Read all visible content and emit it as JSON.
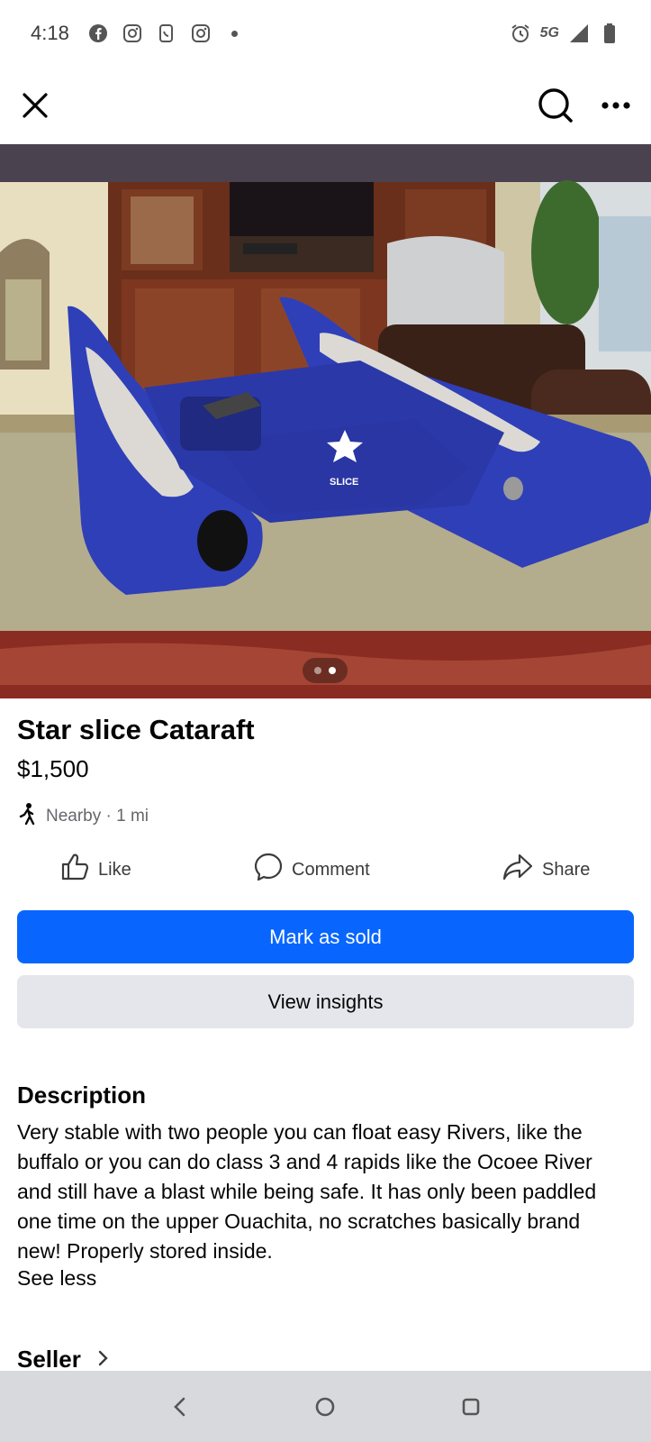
{
  "status_bar": {
    "time": "4:18",
    "left_icons": [
      "facebook-icon",
      "instagram-icon",
      "phone-app-icon",
      "instagram-icon",
      "dot-icon"
    ],
    "network": "5G",
    "right_icons": [
      "alarm-icon",
      "signal-icon",
      "battery-icon"
    ]
  },
  "top_bar": {
    "close_icon": "close-icon",
    "search_icon": "search-icon",
    "more_icon": "more-icon"
  },
  "photo": {
    "total": 2,
    "current": 2,
    "logo_text": "SLICE"
  },
  "listing": {
    "title": "Star slice Cataraft",
    "price": "$1,500",
    "location": "Nearby · 1 mi"
  },
  "actions": {
    "like": "Like",
    "comment": "Comment",
    "share": "Share"
  },
  "buttons": {
    "mark_sold": "Mark as sold",
    "view_insights": "View insights"
  },
  "description": {
    "heading": "Description",
    "body": "Very stable with two people you can float easy Rivers, like the buffalo or you can do class 3 and 4 rapids like the Ocoee River and still have a blast while being safe. It has only been paddled one time on the upper Ouachita, no scratches basically brand new! Properly stored inside.",
    "toggle": "See less"
  },
  "seller": {
    "label": "Seller"
  },
  "colors": {
    "primary": "#0866ff",
    "secondary_button": "#e4e6eb",
    "muted_text": "#65676b",
    "raft_blue": "#2f3fb8"
  }
}
